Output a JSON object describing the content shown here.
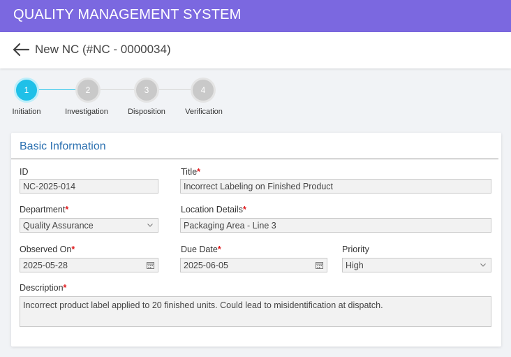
{
  "app": {
    "title": "QUALITY MANAGEMENT SYSTEM"
  },
  "header": {
    "page_title": "New NC (#NC - 0000034)",
    "back_icon": "arrow-left-icon"
  },
  "stepper": {
    "steps": [
      {
        "number": "1",
        "label": "Initiation",
        "active": true
      },
      {
        "number": "2",
        "label": "Investigation",
        "active": false
      },
      {
        "number": "3",
        "label": "Disposition",
        "active": false
      },
      {
        "number": "4",
        "label": "Verification",
        "active": false
      }
    ],
    "active_color": "#1fc0e8",
    "inactive_color": "#c9c9c9"
  },
  "form": {
    "section_title": "Basic Information",
    "id": {
      "label": "ID",
      "value": "NC-2025-014"
    },
    "title": {
      "label": "Title",
      "required": "*",
      "value": "Incorrect Labeling on Finished Product"
    },
    "department": {
      "label": "Department",
      "required": "*",
      "value": "Quality Assurance"
    },
    "location": {
      "label": "Location Details",
      "required": "*",
      "value": "Packaging Area - Line 3"
    },
    "observed_on": {
      "label": "Observed On",
      "required": "*",
      "value": "2025-05-28"
    },
    "due_date": {
      "label": "Due Date",
      "required": "*",
      "value": "2025-06-05"
    },
    "priority": {
      "label": "Priority",
      "value": "High"
    },
    "description": {
      "label": "Description",
      "required": "*",
      "value": "Incorrect product label applied to 20 finished units. Could lead to misidentification at dispatch."
    }
  },
  "colors": {
    "topbar": "#7b68e0",
    "section_title": "#2a6fb0",
    "required": "#e0181b"
  }
}
